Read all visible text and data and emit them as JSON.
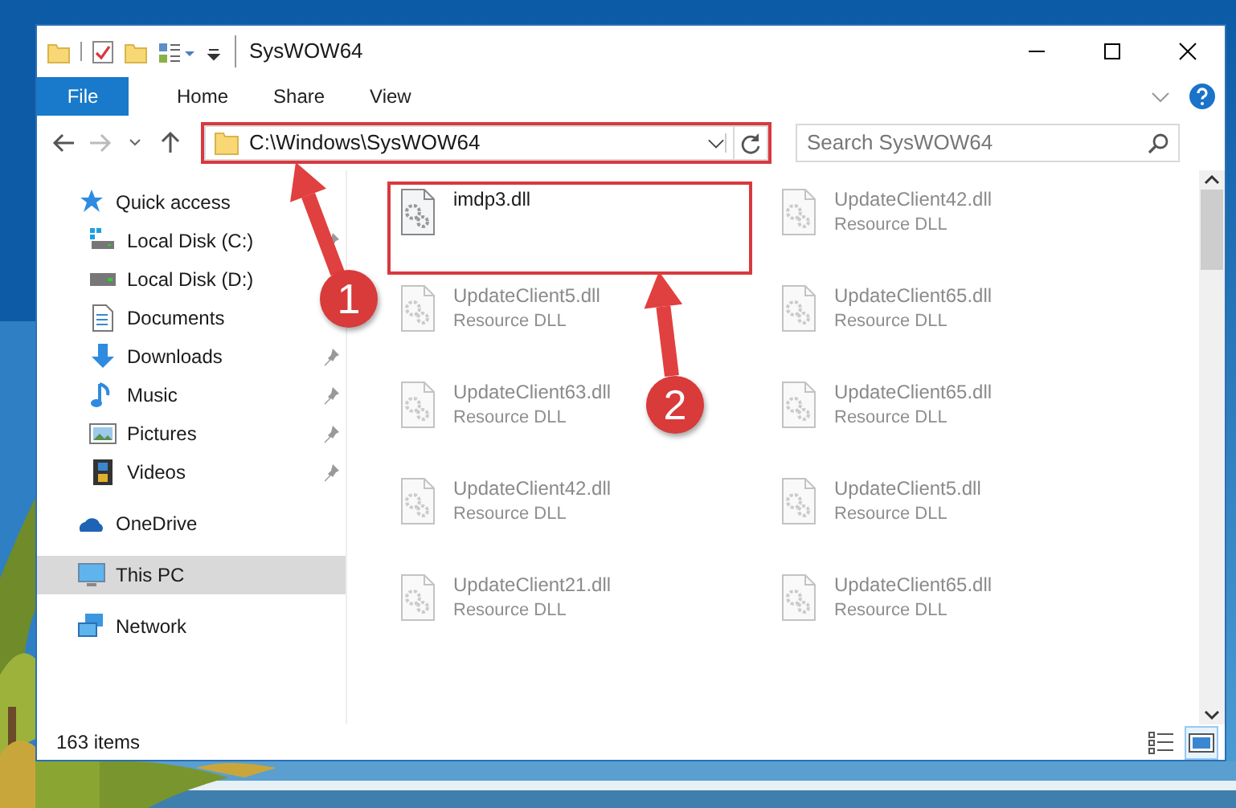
{
  "window": {
    "title": "SysWOW64"
  },
  "ribbon": {
    "tabs": [
      {
        "label": "File",
        "kind": "file"
      },
      {
        "label": "Home",
        "kind": "tab"
      },
      {
        "label": "Share",
        "kind": "tab"
      },
      {
        "label": "View",
        "kind": "tab"
      }
    ]
  },
  "address_bar": {
    "path": "C:\\Windows\\SysWOW64",
    "highlighted": true
  },
  "search": {
    "placeholder": "Search SysWOW64"
  },
  "navigation": [
    {
      "label": "Quick access",
      "kind": "star",
      "selected": false,
      "children": [
        {
          "label": "Local Disk (C:)",
          "kind": "drive-windows",
          "pinned": true,
          "selected": false
        },
        {
          "label": "Local Disk (D:)",
          "kind": "drive",
          "selected": false
        },
        {
          "label": "Documents",
          "kind": "documents",
          "selected": false
        },
        {
          "label": "Downloads",
          "kind": "downloads",
          "pinned": true,
          "selected": false
        },
        {
          "label": "Music",
          "kind": "music",
          "pinned": true,
          "selected": false
        },
        {
          "label": "Pictures",
          "kind": "pictures",
          "pinned": true,
          "selected": false
        },
        {
          "label": "Videos",
          "kind": "videos",
          "pinned": true,
          "selected": false
        }
      ]
    },
    {
      "label": "OneDrive",
      "kind": "cloud",
      "selected": false
    },
    {
      "label": "This PC",
      "kind": "computer",
      "selected": true
    },
    {
      "label": "Network",
      "kind": "network",
      "selected": false
    }
  ],
  "files": [
    {
      "name": "imdp3.dll",
      "faded": false,
      "highlighted": true
    },
    {
      "name": "UpdateClient42.dll",
      "type": "Resource DLL",
      "faded": true,
      "highlighted": false
    },
    {
      "name": "UpdateClient5.dll",
      "type": "Resource DLL",
      "faded": true,
      "highlighted": false
    },
    {
      "name": "UpdateClient65.dll",
      "type": "Resource DLL",
      "faded": true,
      "highlighted": false
    },
    {
      "name": "UpdateClient63.dll",
      "type": "Resource DLL",
      "faded": true,
      "highlighted": false
    },
    {
      "name": "UpdateClient65.dll",
      "type": "Resource DLL",
      "faded": true,
      "highlighted": false
    },
    {
      "name": "UpdateClient42.dll",
      "type": "Resource DLL",
      "faded": true,
      "highlighted": false
    },
    {
      "name": "UpdateClient5.dll",
      "type": "Resource DLL",
      "faded": true,
      "highlighted": false
    },
    {
      "name": "UpdateClient21.dll",
      "type": "Resource DLL",
      "faded": true,
      "highlighted": false
    },
    {
      "name": "UpdateClient65.dll",
      "type": "Resource DLL",
      "faded": true,
      "highlighted": false
    }
  ],
  "status_bar": {
    "item_count": "163 items",
    "view_buttons": [
      {
        "kind": "details",
        "selected": false
      },
      {
        "kind": "large-icons",
        "selected": true
      }
    ]
  },
  "annotations": [
    {
      "number": "1"
    },
    {
      "number": "2"
    }
  ]
}
